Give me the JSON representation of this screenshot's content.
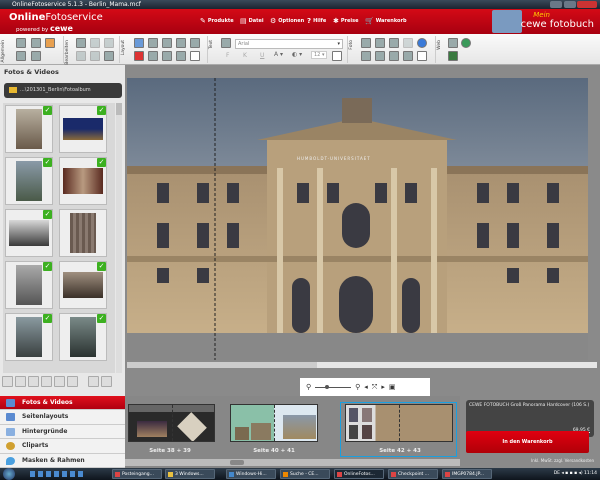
{
  "window": {
    "title": "OnlineFotoservice 5.1.3 - Berlin_Mama.mcf"
  },
  "header": {
    "logo_bold": "Online",
    "logo_rest": "Fotoservice",
    "powered": "powered by",
    "brand": "cewe",
    "mein": "Mein",
    "right_logo": "cewe fotobuch",
    "menu": [
      "Produkte",
      "Datei",
      "Optionen",
      "Hilfe",
      "Preise",
      "Warenkorb"
    ]
  },
  "toolbar": {
    "groups": [
      "Allgemein",
      "Bearbeiten",
      "Layout",
      "Text",
      "Foto",
      "Web"
    ],
    "font": "Arial",
    "font_size": "12",
    "bold": "F",
    "italic": "K",
    "underline": "U"
  },
  "left": {
    "title": "Fotos & Videos",
    "folder": "...\\201301_Berlin\\Fotoalbum",
    "nav": [
      "Fotos & Videos",
      "Seitenlayouts",
      "Hintergründe",
      "Cliparts",
      "Masken & Rahmen"
    ]
  },
  "strip": {
    "pages": [
      "Seite 38 + 39",
      "Seite 40 + 41",
      "Seite 42 + 43"
    ],
    "selected": 2
  },
  "cart": {
    "product": "CEWE FOTOBUCH Groß Panorama Hardcover  (106 S.)",
    "price": "69,95 €",
    "button": "In den Warenkorb",
    "shipping": "Inkl. MwSt. zzgl. Versandkosten"
  },
  "taskbar": {
    "tasks": [
      "Posteingang...",
      "3 Windows...",
      "Windows-Hi...",
      "Suche - CE...",
      "OnlineFotos...",
      "Checkpoint ...",
      "IMGP0784.JP..."
    ],
    "lang": "DE",
    "time": "11:14"
  },
  "photo": {
    "inscription": "HUMBOLDT-UNIVERSITAET"
  }
}
